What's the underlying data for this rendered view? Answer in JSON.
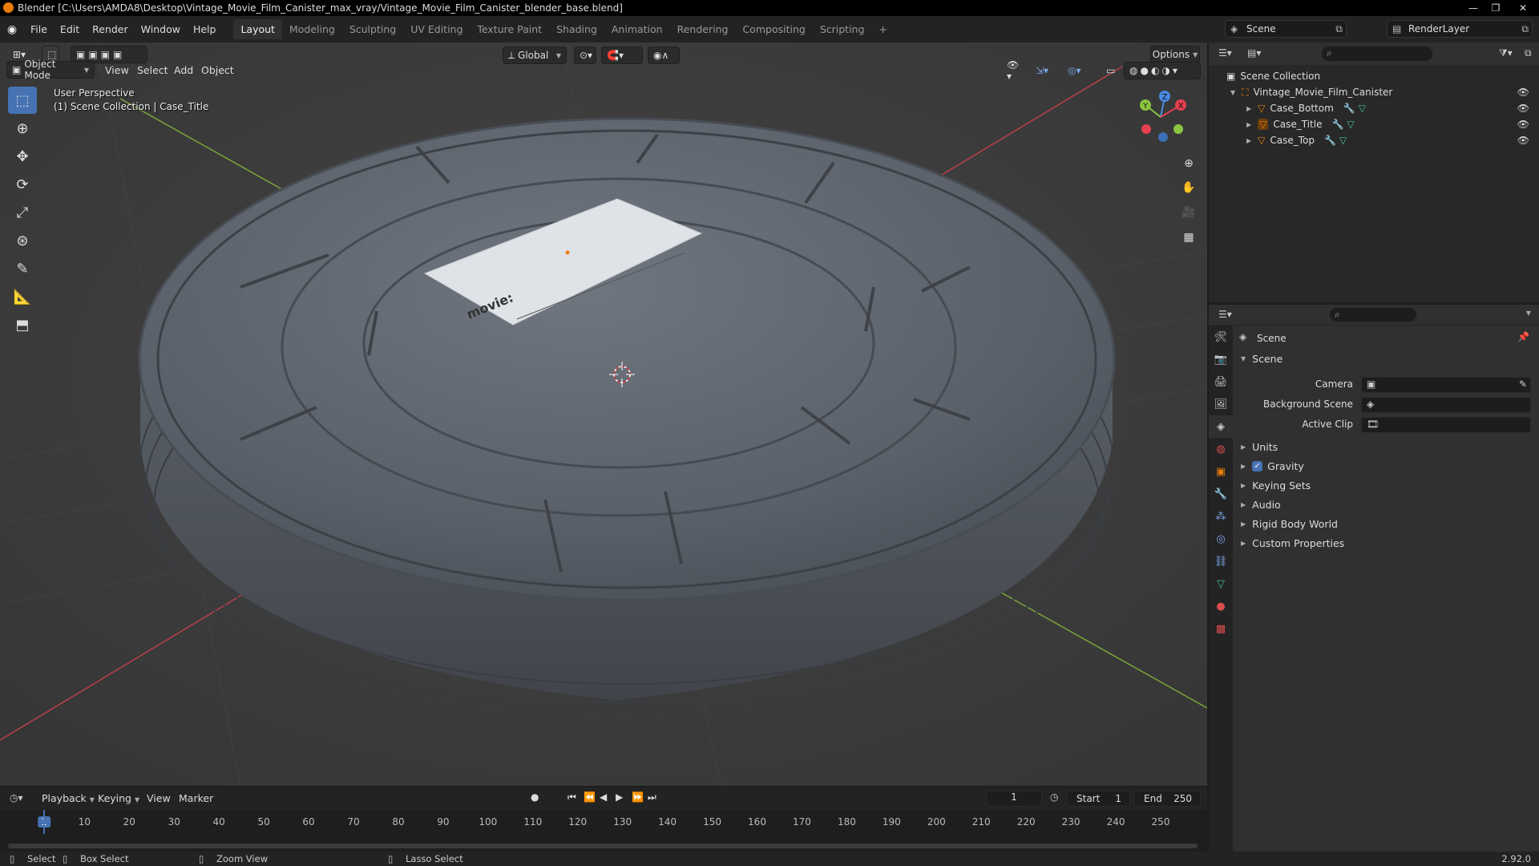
{
  "window": {
    "title": "Blender [C:\\Users\\AMDA8\\Desktop\\Vintage_Movie_Film_Canister_max_vray/Vintage_Movie_Film_Canister_blender_base.blend]",
    "minimize": "—",
    "maximize": "❐",
    "close": "✕"
  },
  "menu": [
    "File",
    "Edit",
    "Render",
    "Window",
    "Help"
  ],
  "workspaces": [
    "Layout",
    "Modeling",
    "Sculpting",
    "UV Editing",
    "Texture Paint",
    "Shading",
    "Animation",
    "Rendering",
    "Compositing",
    "Scripting"
  ],
  "add_workspace": "+",
  "scene_selector": {
    "label": "Scene",
    "renderlayer": "RenderLayer"
  },
  "viewport": {
    "mode": "Object Mode",
    "menus": [
      "View",
      "Select",
      "Add",
      "Object"
    ],
    "transform_orientation": "Global",
    "options": "Options",
    "perspective": "User Perspective",
    "collection_info": "(1) Scene Collection | Case_Title",
    "label_text": "movie:",
    "gizmo": {
      "z": "Z",
      "y": "Y",
      "x": "X"
    }
  },
  "outliner": {
    "root": "Scene Collection",
    "collection": "Vintage_Movie_Film_Canister",
    "objects": [
      "Case_Bottom",
      "Case_Title",
      "Case_Top"
    ]
  },
  "properties": {
    "header": "Scene",
    "panel": "Scene",
    "fields": [
      {
        "label": "Camera",
        "value": ""
      },
      {
        "label": "Background Scene",
        "value": ""
      },
      {
        "label": "Active Clip",
        "value": ""
      }
    ],
    "subpanels": [
      "Units",
      "Gravity",
      "Keying Sets",
      "Audio",
      "Rigid Body World",
      "Custom Properties"
    ],
    "gravity_checked": true
  },
  "timeline": {
    "menus": [
      "Playback",
      "Keying",
      "View",
      "Marker"
    ],
    "current_frame": "1",
    "start_label": "Start",
    "start": "1",
    "end_label": "End",
    "end": "250",
    "ticks": [
      "1",
      "10",
      "20",
      "30",
      "40",
      "50",
      "60",
      "70",
      "80",
      "90",
      "100",
      "110",
      "120",
      "130",
      "140",
      "150",
      "160",
      "170",
      "180",
      "190",
      "200",
      "210",
      "220",
      "230",
      "240",
      "250"
    ]
  },
  "statusbar": {
    "select": "Select",
    "box_select": "Box Select",
    "zoom_view": "Zoom View",
    "lasso_select": "Lasso Select",
    "version": "2.92.0"
  },
  "colors": {
    "accent": "#4772b3",
    "orange": "#e87d0d",
    "x_axis": "#e5404f",
    "y_axis": "#8bc53f",
    "z_axis": "#4a8be5"
  }
}
